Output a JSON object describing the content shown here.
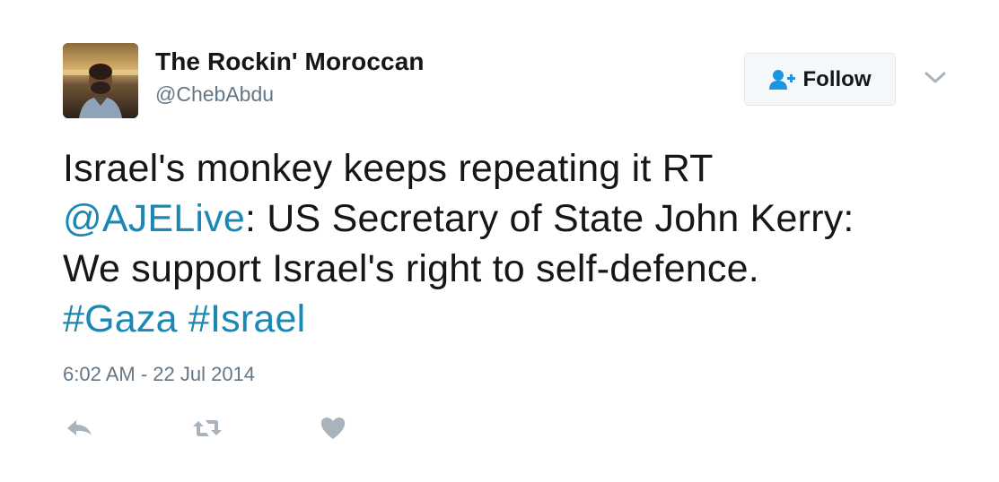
{
  "tweet": {
    "display_name": "The Rockin' Moroccan",
    "handle": "@ChebAbdu",
    "follow_label": "Follow",
    "text": {
      "line1": "Israel's monkey keeps repeating it RT",
      "mention": "@AJELive",
      "line2_rest": ": US Secretary of State John Kerry:",
      "line3": "We support Israel's right to self-defence.",
      "hashtag1": "#Gaza",
      "hashtag2": "#Israel"
    },
    "timestamp": "6:02 AM - 22 Jul 2014"
  },
  "icons": {
    "follow": "add-user-icon",
    "menu": "chevron-down-icon",
    "reply": "reply-icon",
    "retweet": "retweet-icon",
    "like": "heart-icon"
  },
  "colors": {
    "link": "#1a88b5",
    "icon_gray": "#a8b3bd",
    "follow_icon_blue": "#1b95e0",
    "secondary_text": "#657786"
  }
}
